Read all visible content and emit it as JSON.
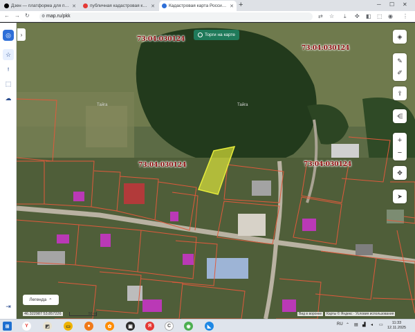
{
  "browser": {
    "tabs": [
      {
        "label": "Дзен — платформа для просмо",
        "fav_color": "#000000"
      },
      {
        "label": "публичная кадастровая карта -",
        "fav_color": "#e53935"
      },
      {
        "label": "Кадастровая карта России онл",
        "fav_color": "#2e6fd8"
      }
    ],
    "new_tab": "+",
    "url": "map.ru/pkk"
  },
  "map": {
    "torgi_label": "Торги на карте",
    "cadastral_labels": [
      "73:04:030124",
      "73:04:030124",
      "73:04:030124",
      "73:04:030124"
    ],
    "place_labels": [
      "Тайга",
      "Тайга"
    ],
    "legend_label": "Легенда",
    "coordinates": "46.322987  53.857226",
    "scale_label": "50 m",
    "view_label": "Вид в воронке",
    "attribution": "Карты © Яндекс · Условия использования",
    "layer_colors": {
      "parcel_border": "#e05a3c",
      "selected_fill": "#e6ec3a",
      "building_fill": "#cc33cc"
    }
  },
  "taskbar": {
    "lang": "RU",
    "time": "11:33",
    "date": "12.11.2025"
  }
}
